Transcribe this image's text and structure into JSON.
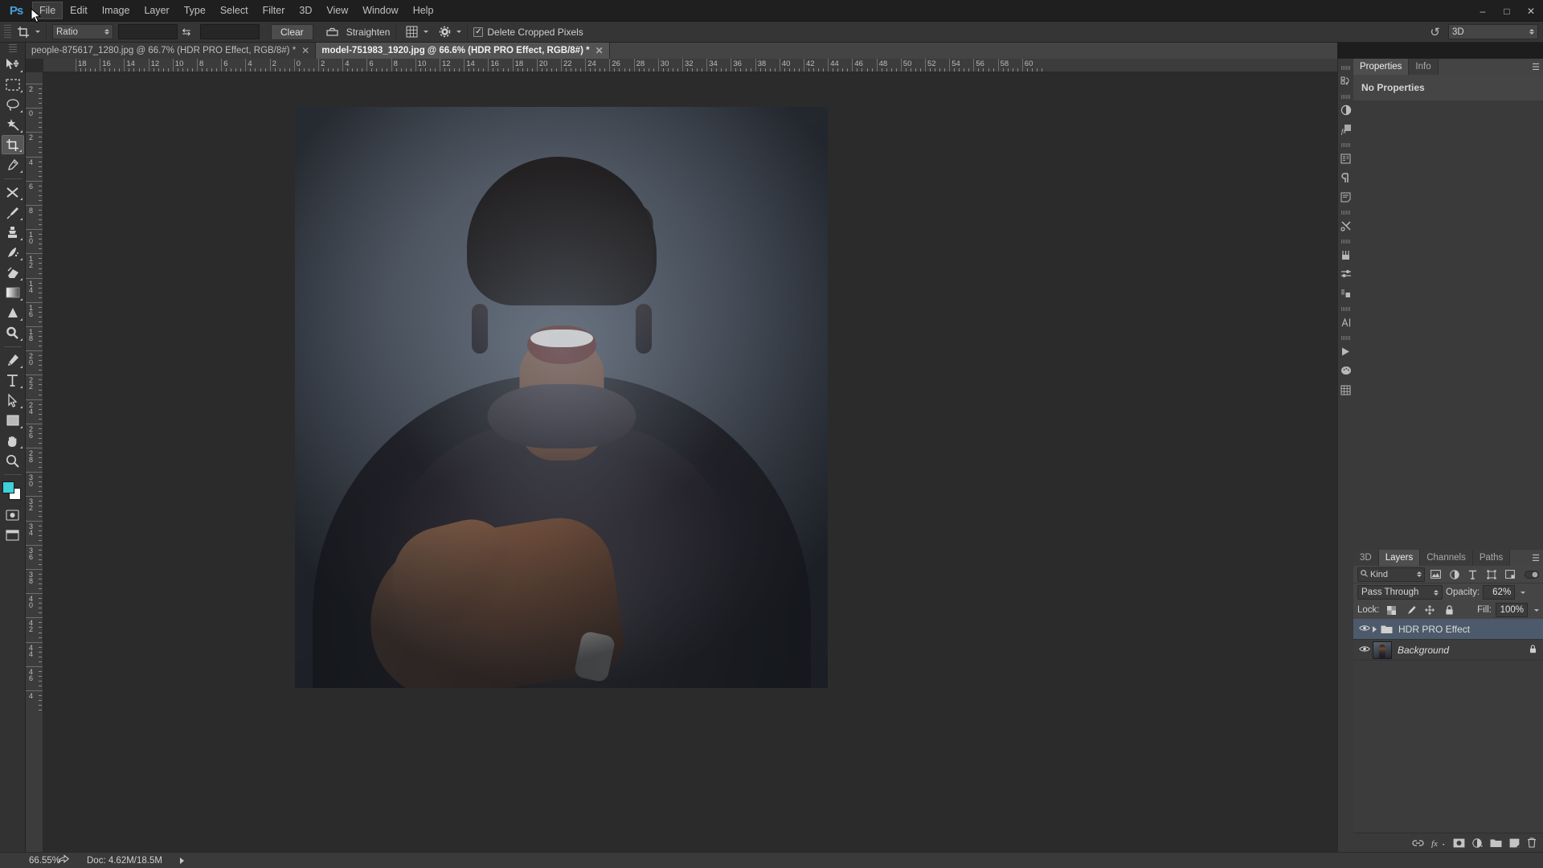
{
  "app": {
    "logo": "Ps",
    "name": "Adobe Photoshop"
  },
  "menubar": {
    "items": [
      {
        "label": "File",
        "active": true
      },
      {
        "label": "Edit",
        "active": false
      },
      {
        "label": "Image",
        "active": false
      },
      {
        "label": "Layer",
        "active": false
      },
      {
        "label": "Type",
        "active": false
      },
      {
        "label": "Select",
        "active": false
      },
      {
        "label": "Filter",
        "active": false
      },
      {
        "label": "3D",
        "active": false
      },
      {
        "label": "View",
        "active": false
      },
      {
        "label": "Window",
        "active": false
      },
      {
        "label": "Help",
        "active": false
      }
    ],
    "window_controls": {
      "minimize": "–",
      "maximize": "□",
      "close": "✕"
    }
  },
  "options_bar": {
    "tool_icon": "crop-tool-icon",
    "ratio_select": "Ratio",
    "width_value": "",
    "height_value": "",
    "swap_icon": "swap-arrows-icon",
    "clear_button": "Clear",
    "straighten_icon": "straighten-icon",
    "straighten_label": "Straighten",
    "overlay_icon": "grid-overlay-icon",
    "settings_icon": "gear-icon",
    "delete_cropped_checked": true,
    "delete_cropped_label": "Delete Cropped Pixels",
    "reset_icon": "reset-icon",
    "workspace_select": "3D"
  },
  "toolbar": {
    "tools": [
      {
        "name": "move-tool",
        "selected": false
      },
      {
        "name": "rectangular-marquee-tool",
        "selected": false
      },
      {
        "name": "lasso-tool",
        "selected": false
      },
      {
        "name": "magic-wand-tool",
        "selected": false
      },
      {
        "name": "crop-tool",
        "selected": true
      },
      {
        "name": "eyedropper-tool",
        "selected": false
      },
      {
        "name": "healing-brush-tool",
        "selected": false
      },
      {
        "name": "brush-tool",
        "selected": false
      },
      {
        "name": "clone-stamp-tool",
        "selected": false
      },
      {
        "name": "history-brush-tool",
        "selected": false
      },
      {
        "name": "eraser-tool",
        "selected": false
      },
      {
        "name": "gradient-tool",
        "selected": false
      },
      {
        "name": "blur-tool",
        "selected": false
      },
      {
        "name": "dodge-tool",
        "selected": false
      },
      {
        "name": "pen-tool",
        "selected": false
      },
      {
        "name": "horizontal-type-tool",
        "selected": false
      },
      {
        "name": "path-selection-tool",
        "selected": false
      },
      {
        "name": "rectangle-tool",
        "selected": false
      },
      {
        "name": "hand-tool",
        "selected": false
      },
      {
        "name": "zoom-tool",
        "selected": false
      }
    ],
    "foreground_color": "#3fd0d8",
    "background_color": "#ffffff",
    "quick_mask_icon": "quick-mask-icon",
    "screen_mode_icon": "screen-mode-icon"
  },
  "document_tabs": [
    {
      "label": "people-875617_1280.jpg @ 66.7% (HDR PRO Effect, RGB/8#) *",
      "active": false,
      "close": "✕"
    },
    {
      "label": "model-751983_1920.jpg @ 66.6% (HDR PRO Effect, RGB/8#) *",
      "active": true,
      "close": "✕"
    }
  ],
  "rulers": {
    "horizontal_labels": [
      "18",
      "16",
      "14",
      "12",
      "10",
      "8",
      "6",
      "4",
      "2",
      "0",
      "2",
      "4",
      "6",
      "8",
      "10",
      "12",
      "14",
      "16",
      "18",
      "20",
      "22",
      "24",
      "26",
      "28",
      "30",
      "32",
      "34",
      "36",
      "38",
      "40",
      "42",
      "44",
      "46",
      "48",
      "50",
      "52",
      "54",
      "56",
      "58",
      "60"
    ],
    "vertical_labels": [
      "2",
      "0",
      "2",
      "4",
      "6",
      "8",
      "10",
      "12",
      "14",
      "16",
      "18",
      "20",
      "22",
      "24",
      "26",
      "28",
      "30",
      "32",
      "34",
      "36",
      "38",
      "40",
      "42",
      "44",
      "46",
      "4"
    ]
  },
  "properties_panel": {
    "tabs": [
      {
        "label": "Properties",
        "active": true
      },
      {
        "label": "Info",
        "active": false
      }
    ],
    "empty_message": "No Properties",
    "menu_icon": "panel-menu-icon"
  },
  "layers_panel": {
    "tabs": [
      {
        "label": "3D",
        "active": false
      },
      {
        "label": "Layers",
        "active": true
      },
      {
        "label": "Channels",
        "active": false
      },
      {
        "label": "Paths",
        "active": false
      }
    ],
    "menu_icon": "panel-menu-icon",
    "filter": {
      "kind_label": "Kind",
      "search_icon": "search-icon",
      "icons": [
        "pixel-filter-icon",
        "adjustment-filter-icon",
        "type-filter-icon",
        "shape-filter-icon",
        "smart-object-filter-icon"
      ],
      "toggle_icon": "filter-toggle-icon"
    },
    "blend_mode": "Pass Through",
    "opacity_label": "Opacity:",
    "opacity_value": "62%",
    "lock_label": "Lock:",
    "lock_icons": [
      "lock-transparent-pixels-icon",
      "lock-image-pixels-icon",
      "lock-position-icon",
      "lock-all-icon"
    ],
    "fill_label": "Fill:",
    "fill_value": "100%",
    "layers": [
      {
        "name": "HDR PRO Effect",
        "type": "group",
        "visible": true,
        "selected": true,
        "locked": false,
        "italic": false
      },
      {
        "name": "Background",
        "type": "image",
        "visible": true,
        "selected": false,
        "locked": true,
        "italic": true
      }
    ],
    "footer_icons": [
      "link-layers-icon",
      "layer-style-fx-icon",
      "add-layer-mask-icon",
      "new-adjustment-layer-icon",
      "new-group-icon",
      "new-layer-icon",
      "delete-layer-icon"
    ]
  },
  "icon_dock": {
    "icons": [
      "history-icon",
      "color-wheel-icon",
      "styles-fx-icon",
      "paragraph-styles-icon",
      "paragraph-icon",
      "notes-icon",
      "tools-icon",
      "brush-presets-icon",
      "brush-settings-icon",
      "layer-comps-icon",
      "character-icon",
      "timeline-icon",
      "swatches-icon",
      "pattern-icon"
    ]
  },
  "status_bar": {
    "zoom": "66.55%",
    "share_icon": "share-icon",
    "doc_info": "Doc: 4.62M/18.5M",
    "expand_icon": "expand-arrow-icon"
  }
}
